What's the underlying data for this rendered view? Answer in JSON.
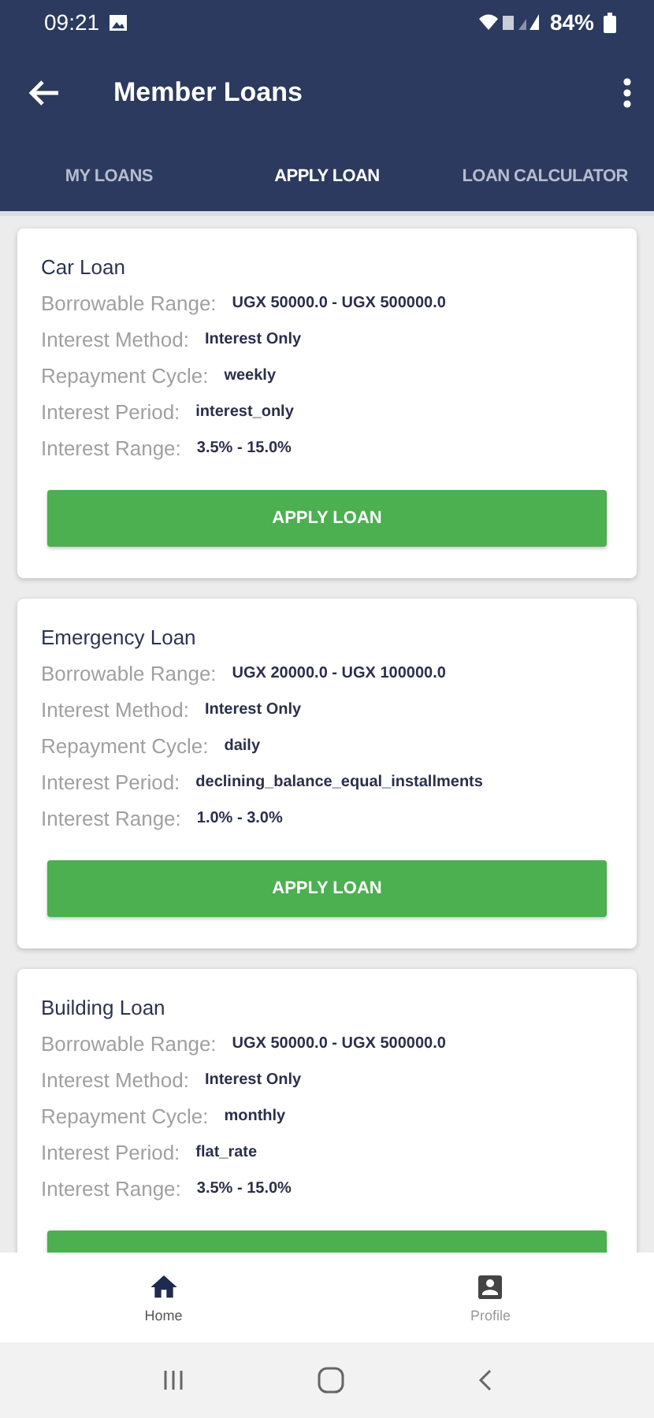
{
  "status_bar": {
    "time": "09:21",
    "battery": "84%"
  },
  "app_bar": {
    "title": "Member Loans"
  },
  "tabs": [
    {
      "label": "MY LOANS",
      "selected": false
    },
    {
      "label": "APPLY LOAN",
      "selected": true
    },
    {
      "label": "LOAN CALCULATOR",
      "selected": false
    }
  ],
  "loans": [
    {
      "name": "Car Loan",
      "fields": [
        {
          "label": "Borrowable Range:",
          "value": "UGX 50000.0 - UGX 500000.0"
        },
        {
          "label": "Interest Method:",
          "value": "Interest Only"
        },
        {
          "label": "Repayment Cycle:",
          "value": "weekly"
        },
        {
          "label": "Interest Period:",
          "value": "interest_only"
        },
        {
          "label": "Interest Range:",
          "value": "3.5% - 15.0%"
        }
      ],
      "button": "APPLY LOAN"
    },
    {
      "name": "Emergency Loan",
      "fields": [
        {
          "label": "Borrowable Range:",
          "value": "UGX 20000.0 - UGX 100000.0"
        },
        {
          "label": "Interest Method:",
          "value": "Interest Only"
        },
        {
          "label": "Repayment Cycle:",
          "value": "daily"
        },
        {
          "label": "Interest Period:",
          "value": "declining_balance_equal_installments"
        },
        {
          "label": "Interest Range:",
          "value": "1.0% - 3.0%"
        }
      ],
      "button": "APPLY LOAN"
    },
    {
      "name": "Building  Loan",
      "fields": [
        {
          "label": "Borrowable Range:",
          "value": "UGX 50000.0 - UGX 500000.0"
        },
        {
          "label": "Interest Method:",
          "value": "Interest Only"
        },
        {
          "label": "Repayment Cycle:",
          "value": "monthly"
        },
        {
          "label": "Interest Period:",
          "value": "flat_rate"
        },
        {
          "label": "Interest Range:",
          "value": "3.5% - 15.0%"
        }
      ]
    }
  ],
  "bottom_nav": [
    {
      "kind": "home",
      "label": "Home",
      "selected": true
    },
    {
      "kind": "profile",
      "label": "Profile",
      "selected": false
    }
  ]
}
